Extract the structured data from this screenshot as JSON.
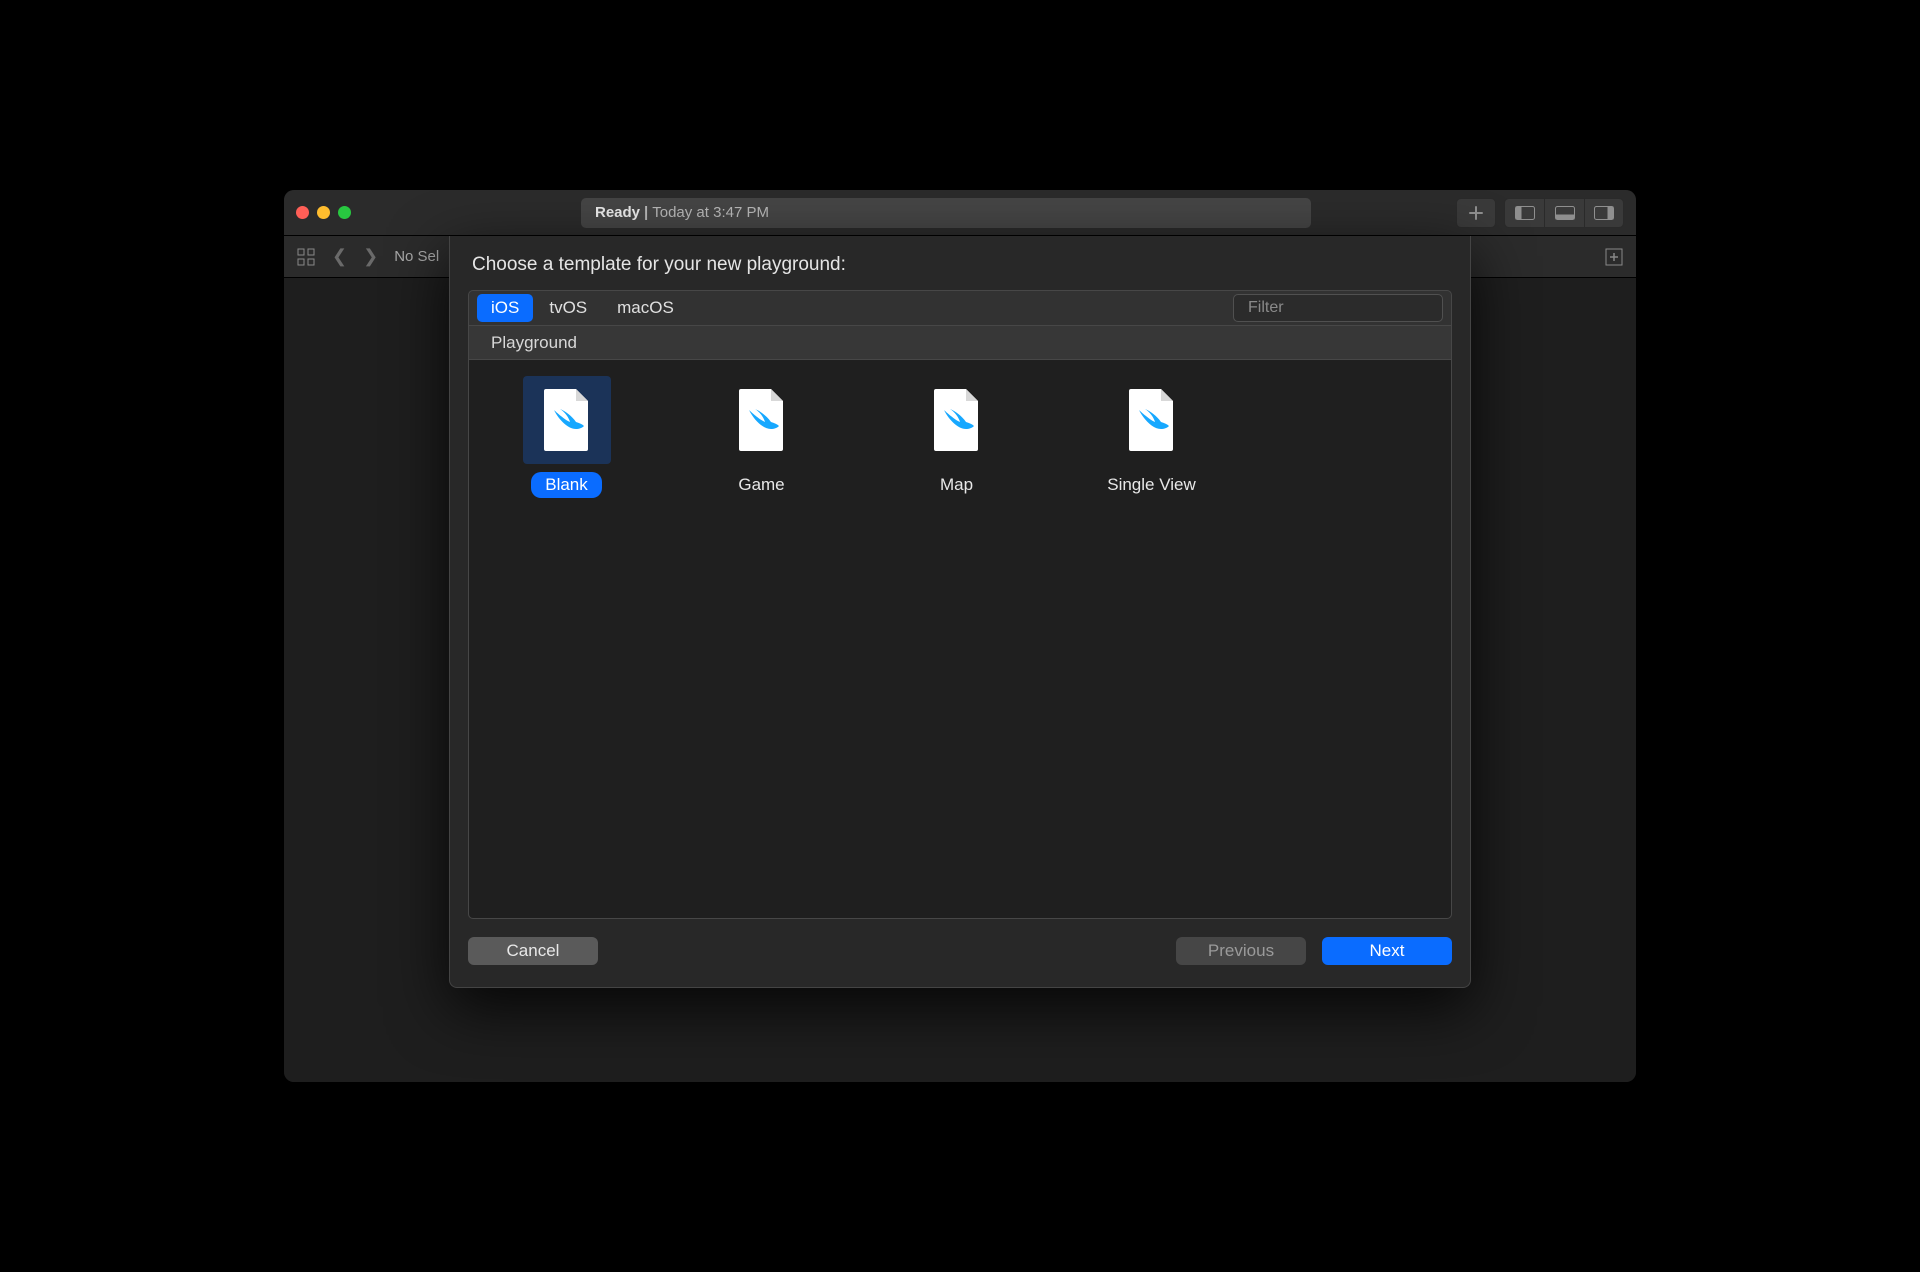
{
  "titlebar": {
    "status_ready": "Ready",
    "status_divider": "|",
    "status_time": "Today at 3:47 PM"
  },
  "toolbar": {
    "nosel": "No Sel"
  },
  "dialog": {
    "title": "Choose a template for your new playground:",
    "tabs": {
      "ios": "iOS",
      "tvos": "tvOS",
      "macos": "macOS"
    },
    "filter_placeholder": "Filter",
    "section": "Playground",
    "templates": {
      "blank": "Blank",
      "game": "Game",
      "map": "Map",
      "single_view": "Single View"
    },
    "buttons": {
      "cancel": "Cancel",
      "previous": "Previous",
      "next": "Next"
    }
  }
}
